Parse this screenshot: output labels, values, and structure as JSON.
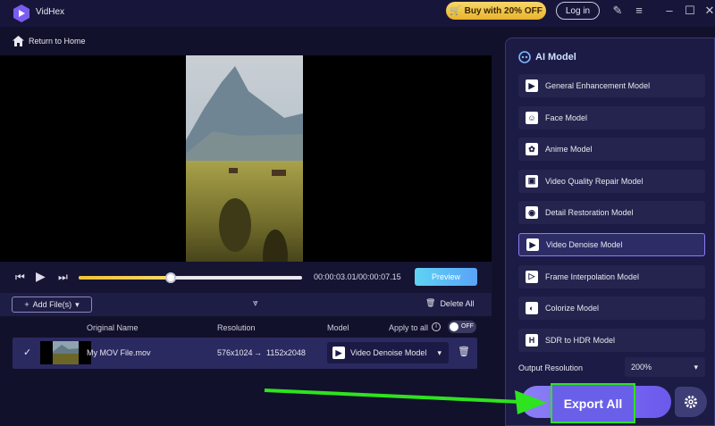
{
  "app": {
    "name": "VidHex"
  },
  "titlebar": {
    "buy_label": "Buy with 20% OFF",
    "login_label": "Log in"
  },
  "nav": {
    "back_label": "Return to Home"
  },
  "player": {
    "timecode": "00:00:03.01/00:00:07.15",
    "progress": 0.41,
    "preview_label": "Preview"
  },
  "filebar": {
    "add_label": "Add File(s)",
    "delete_all_label": "Delete All"
  },
  "table": {
    "headers": {
      "original_name": "Original Name",
      "resolution": "Resolution",
      "model": "Model",
      "apply_to_all": "Apply to all"
    },
    "toggle_label": "OFF",
    "rows": [
      {
        "name": "My MOV File.mov",
        "resolution_from": "576x1024",
        "resolution_to": "1152x2048",
        "model": "Video Denoise Model"
      }
    ]
  },
  "ai_panel": {
    "title": "AI Model",
    "models": [
      {
        "label": "General Enhancement Model",
        "icon": "play-sparkle-icon",
        "active": false
      },
      {
        "label": "Face Model",
        "icon": "face-icon",
        "active": false
      },
      {
        "label": "Anime Model",
        "icon": "anime-icon",
        "active": false
      },
      {
        "label": "Video Quality Repair Model",
        "icon": "repair-icon",
        "active": false
      },
      {
        "label": "Detail Restoration Model",
        "icon": "detail-icon",
        "active": false
      },
      {
        "label": "Video Denoise Model",
        "icon": "denoise-icon",
        "active": true
      },
      {
        "label": "Frame Interpolation Model",
        "icon": "frame-icon",
        "active": false
      },
      {
        "label": "Colorize Model",
        "icon": "colorize-icon",
        "active": false
      },
      {
        "label": "SDR to HDR Model",
        "icon": "hdr-icon",
        "active": false
      }
    ],
    "output_resolution_label": "Output Resolution",
    "output_resolution_value": "200%",
    "export_label": "Export All"
  },
  "colors": {
    "accent": "#6a5fe9",
    "highlight": "#2ee31f",
    "buy": "#f2c233"
  }
}
